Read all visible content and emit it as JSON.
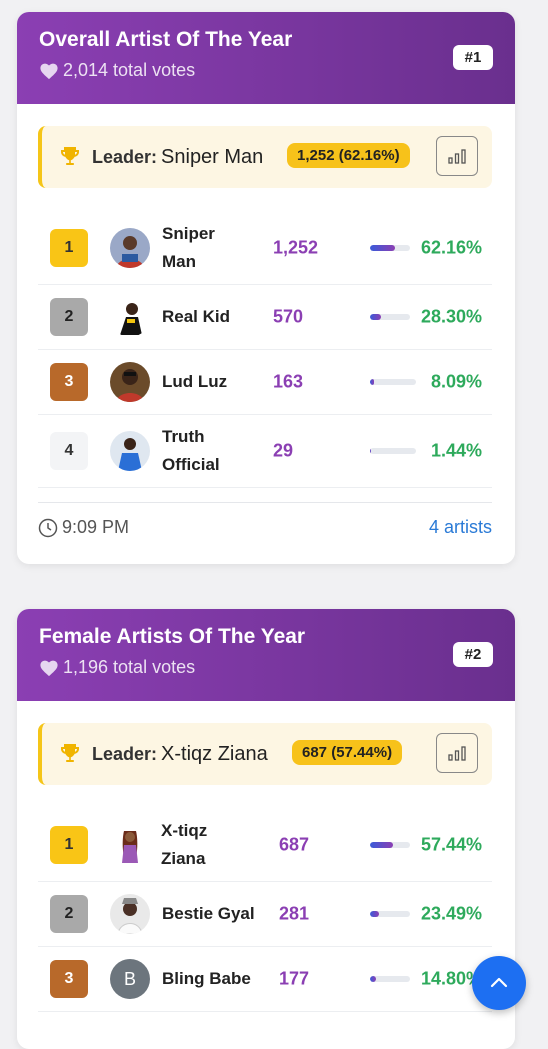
{
  "polls": [
    {
      "title": "Overall Artist Of The Year",
      "total_votes": "2,014 total votes",
      "rank": "#1",
      "leader_label": "Leader:",
      "leader_name": "Sniper Man",
      "leader_votes": "1,252 (62.16%)",
      "entries": [
        {
          "position": "1",
          "name": "Sniper Man",
          "votes": "1,252",
          "percent": "62.16%",
          "share": 0.6216
        },
        {
          "position": "2",
          "name": "Real Kid",
          "votes": "570",
          "percent": "28.30%",
          "share": 0.283
        },
        {
          "position": "3",
          "name": "Lud Luz",
          "votes": "163",
          "percent": "8.09%",
          "share": 0.0809
        },
        {
          "position": "4",
          "name": "Truth Official",
          "votes": "29",
          "percent": "1.44%",
          "share": 0.0144
        }
      ],
      "time": "9:09 PM",
      "artists_count": "4 artists"
    },
    {
      "title": "Female Artists Of The Year",
      "total_votes": "1,196 total votes",
      "rank": "#2",
      "leader_label": "Leader:",
      "leader_name": "X-tiqz Ziana",
      "leader_votes": "687 (57.44%)",
      "entries": [
        {
          "position": "1",
          "name": "X-tiqz Ziana",
          "votes": "687",
          "percent": "57.44%",
          "share": 0.5744
        },
        {
          "position": "2",
          "name": "Bestie Gyal",
          "votes": "281",
          "percent": "23.49%",
          "share": 0.2349
        },
        {
          "position": "3",
          "name": "Bling Babe",
          "votes": "177",
          "percent": "14.80%",
          "share": 0.148,
          "avatar_letter": "B"
        }
      ]
    }
  ],
  "colors": {
    "accent": "#8b3fb3",
    "gold": "#f9c516",
    "green": "#2eaa5c",
    "link": "#2a7ad6",
    "fab": "#1d6ff2"
  },
  "icons": {
    "heart": "heart-icon",
    "trophy": "trophy-icon",
    "stats": "bar-chart-icon",
    "clock": "clock-icon",
    "scroll_top": "chevron-up-icon"
  }
}
